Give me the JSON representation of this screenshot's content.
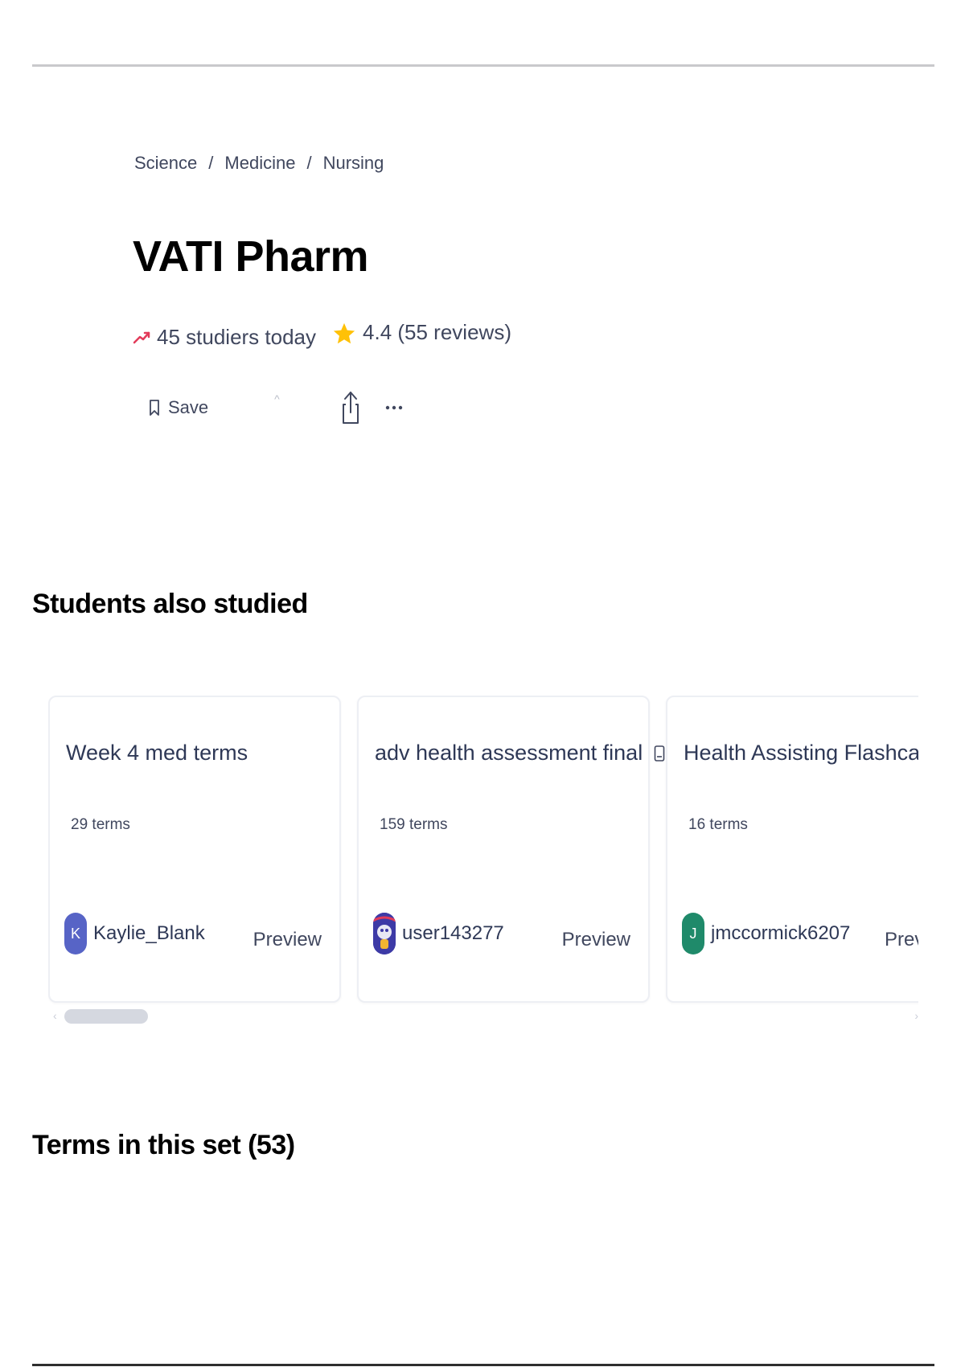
{
  "breadcrumb": [
    "Science",
    "Medicine",
    "Nursing"
  ],
  "breadcrumb_separator": "/",
  "title": "VATI Pharm",
  "stats": {
    "studiers": "45 studiers today",
    "rating": "4.4 (55 reviews)"
  },
  "actions": {
    "save_label": "Save",
    "caret": "^",
    "more": "···"
  },
  "sections": {
    "students_also_studied": "Students also studied",
    "terms_in_set": "Terms in this set (53)"
  },
  "cards": [
    {
      "title": "Week 4 med terms",
      "terms": "29 terms",
      "author": "Kaylie_Blank",
      "avatar_letter": "K",
      "preview": "Preview"
    },
    {
      "title": "adv health assessment final",
      "terms": "159 terms",
      "author": "user143277",
      "avatar_letter": "",
      "preview": "Preview"
    },
    {
      "title": "Health Assisting Flashcards Chapte",
      "terms": "16 terms",
      "author": "jmccormick6207",
      "avatar_letter": "J",
      "preview": "Previe"
    }
  ],
  "colors": {
    "trend": "#e23b5a",
    "star": "#ffc107",
    "avatar_k": "#5764c6",
    "avatar_j": "#1f8a6a"
  },
  "icons": [
    "trend-up-icon",
    "star-icon",
    "bookmark-icon",
    "share-icon",
    "more-icon",
    "document-icon"
  ]
}
